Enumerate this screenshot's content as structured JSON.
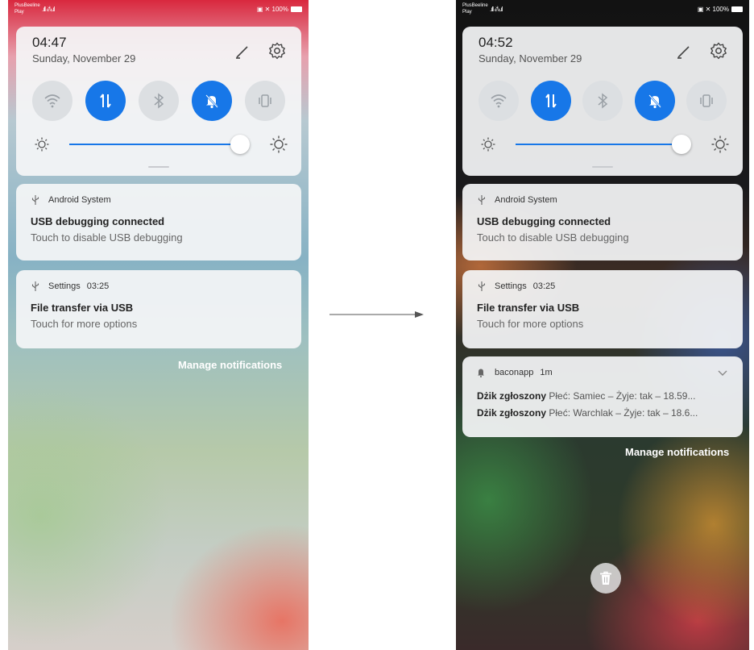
{
  "status_bar": {
    "carrier_line1": "PlusBeeline",
    "carrier_line2": "Play",
    "signal": ".ıll ⁂.ıl",
    "right": "▣ ✕ 100%"
  },
  "left": {
    "time": "04:47",
    "date": "Sunday, November 29",
    "notifications": [
      {
        "app": "Android System",
        "time": "",
        "title": "USB debugging connected",
        "text": "Touch to disable USB debugging"
      },
      {
        "app": "Settings",
        "time": "03:25",
        "title": "File transfer via USB",
        "text": "Touch for more options"
      }
    ],
    "manage_label": "Manage notifications"
  },
  "right": {
    "time": "04:52",
    "date": "Sunday, November 29",
    "notifications": [
      {
        "app": "Android System",
        "time": "",
        "title": "USB debugging connected",
        "text": "Touch to disable USB debugging"
      },
      {
        "app": "Settings",
        "time": "03:25",
        "title": "File transfer via USB",
        "text": "Touch for more options"
      }
    ],
    "bacon": {
      "app": "baconapp",
      "time": "1m",
      "lines": [
        {
          "title": "Dżik zgłoszony",
          "text": "Płeć: Samiec – Żyje: tak – 18.59..."
        },
        {
          "title": "Dżik zgłoszony",
          "text": "Płeć: Warchlak – Żyje: tak – 18.6..."
        }
      ]
    },
    "manage_label": "Manage notifications"
  },
  "toggles": [
    {
      "name": "wifi",
      "active": false
    },
    {
      "name": "mobile-data",
      "active": true
    },
    {
      "name": "bluetooth",
      "active": false
    },
    {
      "name": "do-not-disturb",
      "active": true
    },
    {
      "name": "vibrate",
      "active": false
    }
  ],
  "brightness": 0.93,
  "colors": {
    "accent": "#1777e8",
    "toggle_off": "#dcdfe2"
  }
}
